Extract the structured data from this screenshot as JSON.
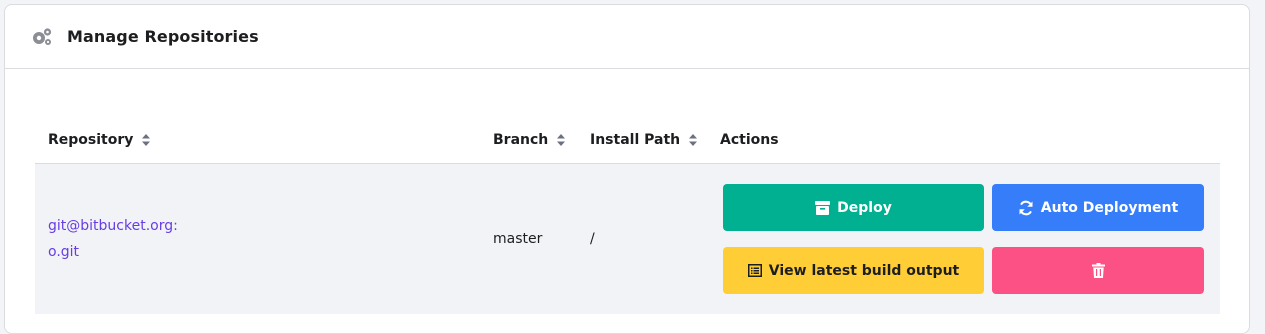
{
  "card": {
    "title": "Manage Repositories",
    "icon": "gears-icon"
  },
  "table": {
    "headers": {
      "repository": "Repository",
      "branch": "Branch",
      "install_path": "Install Path",
      "actions": "Actions"
    },
    "rows": [
      {
        "repository_line1": "git@bitbucket.org:",
        "repository_line2": "o.git",
        "branch": "master",
        "install_path": "/"
      }
    ]
  },
  "buttons": {
    "deploy": "Deploy",
    "auto_deployment": "Auto Deployment",
    "build_output": "View latest build output"
  },
  "colors": {
    "deploy": "#00b090",
    "auto": "#357df9",
    "build": "#ffcd35",
    "delete": "#fc5185",
    "link": "#673de6"
  }
}
